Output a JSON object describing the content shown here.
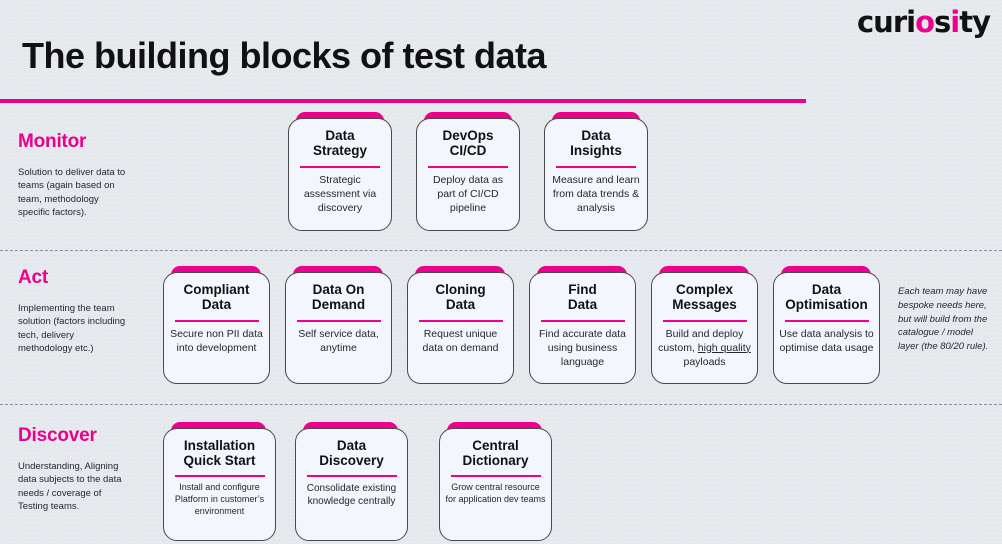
{
  "brand": {
    "logo_pre": "curi",
    "logo_dot1": "o",
    "logo_mid": "s",
    "logo_dot2": "i",
    "logo_post": "ty",
    "logo_full": "curiosity",
    "accent_color": "#ec008c",
    "text_color": "#111111",
    "background_color": "#e5e9ed",
    "card_background": "#f4f6fd"
  },
  "header": {
    "title": "The building blocks of test data"
  },
  "sections": [
    {
      "id": "monitor",
      "label": "Monitor",
      "description": "Solution to deliver data to teams (again based on team, methodology specific factors).",
      "cards": [
        {
          "title": "Data Strategy",
          "title_line1": "Data",
          "title_line2": "Strategy",
          "body": "Strategic assessment via discovery"
        },
        {
          "title": "DevOps CI/CD",
          "title_line1": "DevOps",
          "title_line2": "CI/CD",
          "body": "Deploy data as part of CI/CD pipeline"
        },
        {
          "title": "Data Insights",
          "title_line1": "Data",
          "title_line2": "Insights",
          "body": "Measure and learn from data trends & analysis"
        }
      ]
    },
    {
      "id": "act",
      "label": "Act",
      "description": "Implementing the team solution (factors including tech, delivery methodology etc.)",
      "note": "Each team may have bespoke needs here, but will build from the catalogue / model layer (the 80/20 rule).",
      "cards": [
        {
          "title": "Compliant Data",
          "title_line1": "Compliant",
          "title_line2": "Data",
          "body": "Secure non PII data into development"
        },
        {
          "title": "Data On Demand",
          "title_line1": "Data On",
          "title_line2": "Demand",
          "body": "Self service data, anytime"
        },
        {
          "title": "Cloning Data",
          "title_line1": "Cloning",
          "title_line2": "Data",
          "body": "Request unique data on demand"
        },
        {
          "title": "Find Data",
          "title_line1": "Find",
          "title_line2": "Data",
          "body": "Find accurate data using business language"
        },
        {
          "title": "Complex Messages",
          "title_line1": "Complex",
          "title_line2": "Messages",
          "body": "Build and deploy custom, high quality payloads",
          "body_prefix": "Build and deploy custom, ",
          "body_underlined": "high quality",
          "body_suffix": " payloads"
        },
        {
          "title": "Data Optimisation",
          "title_line1": "Data",
          "title_line2": "Optimisation",
          "body": "Use data analysis to optimise data usage"
        }
      ]
    },
    {
      "id": "discover",
      "label": "Discover",
      "description": "Understanding, Aligning data subjects to the data needs / coverage of Testing teams.",
      "cards": [
        {
          "title": "Installation Quick Start",
          "title_line1": "Installation",
          "title_line2": "Quick Start",
          "body": "Install and configure Platform in customer’s environment"
        },
        {
          "title": "Data Discovery",
          "title_line1": "Data",
          "title_line2": "Discovery",
          "body": "Consolidate existing knowledge centrally"
        },
        {
          "title": "Central Dictionary",
          "title_line1": "Central",
          "title_line2": "Dictionary",
          "body": "Grow central resource for application dev teams"
        }
      ]
    }
  ]
}
